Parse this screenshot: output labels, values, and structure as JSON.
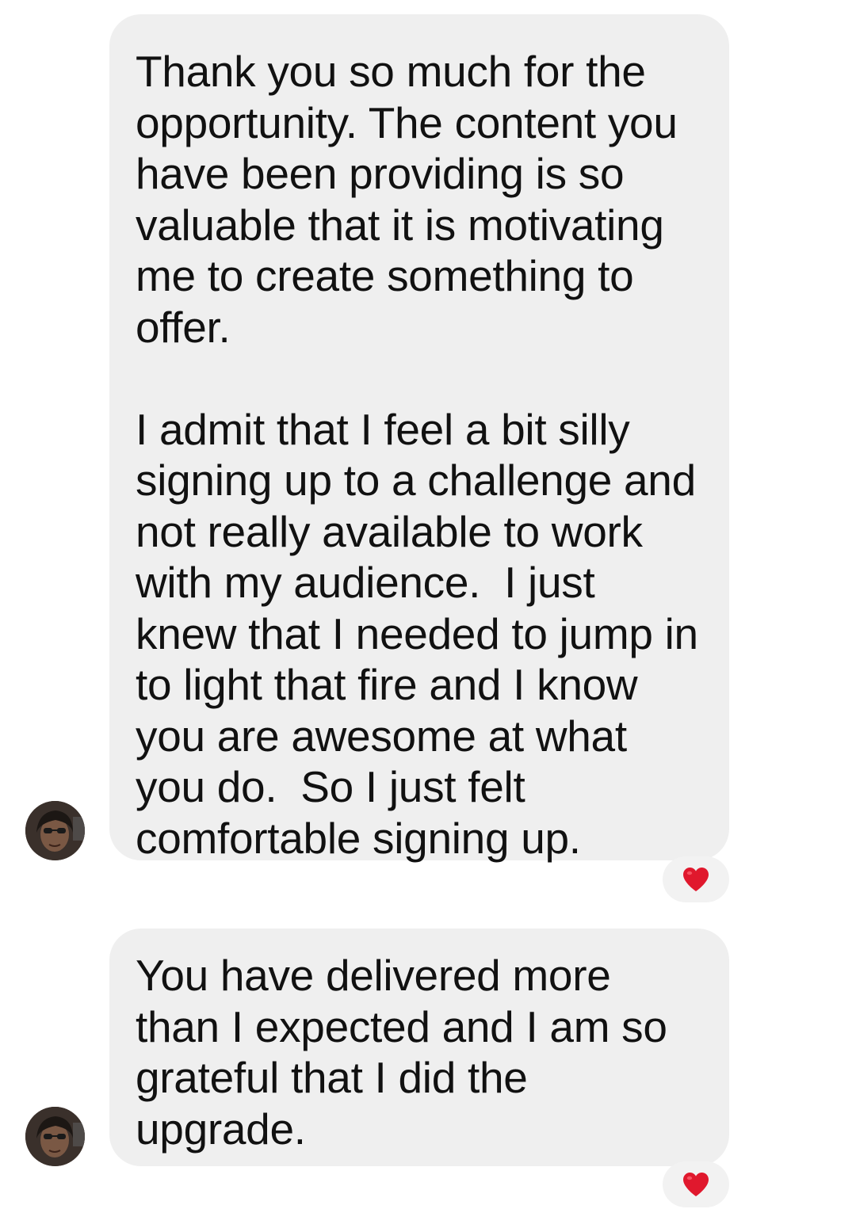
{
  "messages": [
    {
      "paragraphs": [
        "Thank you so much for the opportunity. The content you have been providing is so valuable that it is motivating me to create something to offer.",
        "I admit that I feel a bit silly signing up to a challenge and not really available to work with my audience.  I just knew that I needed to jump in to light that fire and I know you are awesome at what you do.  So I just felt comfortable signing up."
      ],
      "reaction": "heart-icon"
    },
    {
      "paragraphs": [
        "You have delivered more than I expected and I am so grateful that I did the upgrade."
      ],
      "reaction": "heart-icon"
    }
  ],
  "colors": {
    "bubble": "#efefef",
    "text": "#111111",
    "heart": "#e0182d",
    "reaction_pill": "#f2f2f2"
  }
}
